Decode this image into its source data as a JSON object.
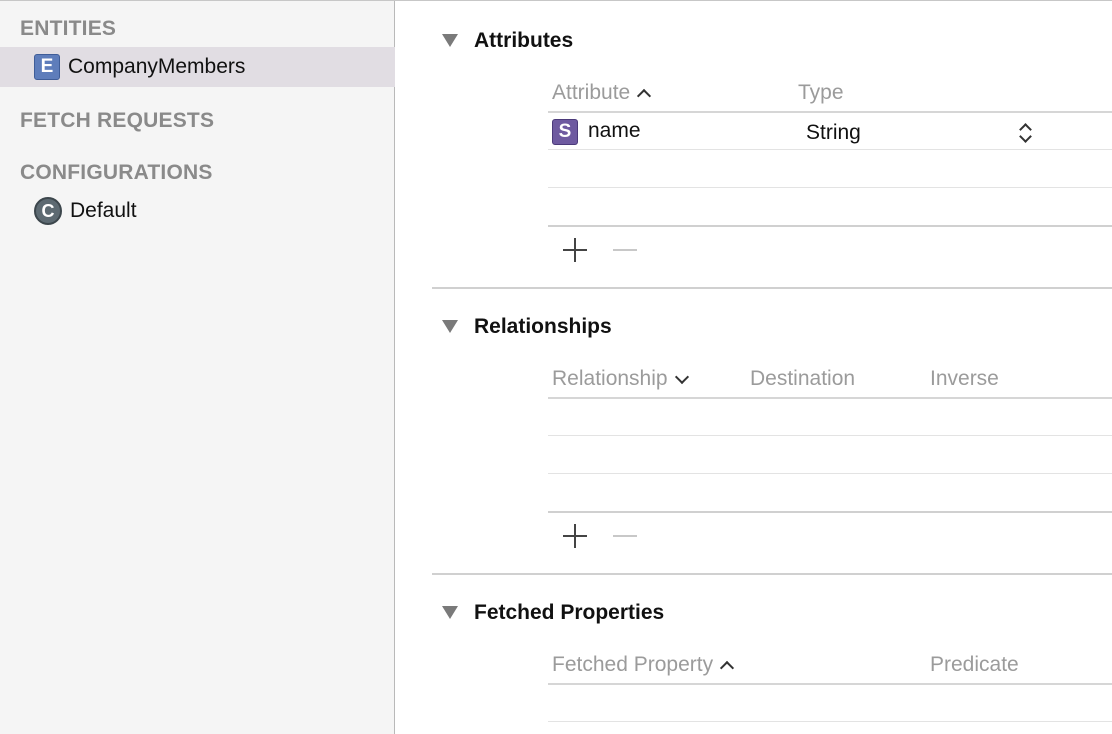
{
  "sidebar": {
    "entities_header": "ENTITIES",
    "entities": [
      {
        "badge": "E",
        "label": "CompanyMembers",
        "selected": true
      }
    ],
    "fetch_requests_header": "FETCH REQUESTS",
    "configurations_header": "CONFIGURATIONS",
    "configurations": [
      {
        "badge": "C",
        "label": "Default"
      }
    ]
  },
  "attributes": {
    "title": "Attributes",
    "columns": [
      "Attribute",
      "Type"
    ],
    "rows": [
      {
        "badge": "S",
        "name": "name",
        "type": "String"
      }
    ]
  },
  "relationships": {
    "title": "Relationships",
    "columns": [
      "Relationship",
      "Destination",
      "Inverse"
    ]
  },
  "fetched_properties": {
    "title": "Fetched Properties",
    "columns": [
      "Fetched Property",
      "Predicate"
    ]
  },
  "colors": {
    "entity_badge": "#5e7dbb",
    "string_badge": "#6e5aa0",
    "config_badge": "#5d6a72",
    "selection": "#e1dde3"
  },
  "icons": [
    "disclosure-triangle-icon",
    "sort-ascending-icon",
    "sort-descending-icon",
    "add-icon",
    "remove-icon",
    "stepper-icon"
  ]
}
